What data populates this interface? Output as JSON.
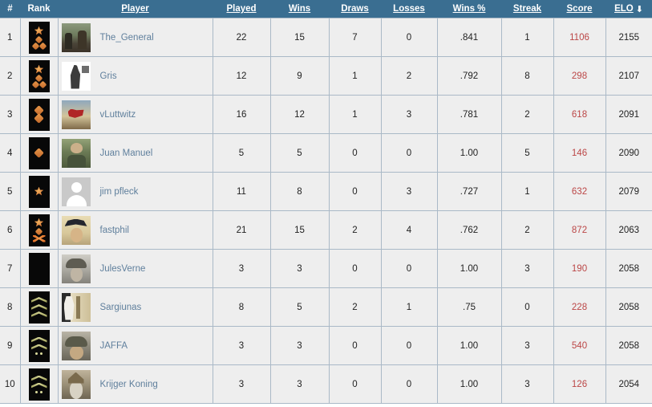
{
  "table": {
    "columns": [
      {
        "key": "num",
        "label": "#",
        "sortable": false,
        "sorted": false
      },
      {
        "key": "rank",
        "label": "Rank",
        "sortable": false,
        "sorted": false
      },
      {
        "key": "player",
        "label": "Player",
        "sortable": true,
        "sorted": false
      },
      {
        "key": "played",
        "label": "Played",
        "sortable": true,
        "sorted": false
      },
      {
        "key": "wins",
        "label": "Wins",
        "sortable": true,
        "sorted": false
      },
      {
        "key": "draws",
        "label": "Draws",
        "sortable": true,
        "sorted": false
      },
      {
        "key": "losses",
        "label": "Losses",
        "sortable": true,
        "sorted": false
      },
      {
        "key": "winpct",
        "label": "Wins %",
        "sortable": true,
        "sorted": false
      },
      {
        "key": "streak",
        "label": "Streak",
        "sortable": true,
        "sorted": false
      },
      {
        "key": "score",
        "label": "Score",
        "sortable": true,
        "sorted": false
      },
      {
        "key": "elo",
        "label": "ELO",
        "sortable": true,
        "sorted": true,
        "sort_direction": "desc",
        "sort_arrow": "⬇"
      }
    ],
    "rows": [
      {
        "num": "1",
        "player": "The_General",
        "played": "22",
        "wins": "15",
        "draws": "7",
        "losses": "0",
        "winpct": ".841",
        "streak": "1",
        "score": "1106",
        "elo": "2155",
        "rank_insignia": "two-diamonds-plus-one",
        "avatar_art": "av-landscape"
      },
      {
        "num": "2",
        "player": "Gris",
        "played": "12",
        "wins": "9",
        "draws": "1",
        "losses": "2",
        "winpct": ".792",
        "streak": "8",
        "score": "298",
        "elo": "2107",
        "rank_insignia": "two-diamonds-plus-one",
        "avatar_art": "av-cloak"
      },
      {
        "num": "3",
        "player": "vLuttwitz",
        "played": "16",
        "wins": "12",
        "draws": "1",
        "losses": "3",
        "winpct": ".781",
        "streak": "2",
        "score": "618",
        "elo": "2091",
        "rank_insignia": "two-diamonds",
        "avatar_art": "av-flag"
      },
      {
        "num": "4",
        "player": "Juan Manuel",
        "played": "5",
        "wins": "5",
        "draws": "0",
        "losses": "0",
        "winpct": "1.00",
        "streak": "5",
        "score": "146",
        "elo": "2090",
        "rank_insignia": "one-diamond",
        "avatar_art": "av-soldier"
      },
      {
        "num": "5",
        "player": "jim pfleck",
        "played": "11",
        "wins": "8",
        "draws": "0",
        "losses": "3",
        "winpct": ".727",
        "streak": "1",
        "score": "632",
        "elo": "2079",
        "rank_insignia": "star",
        "avatar_art": "av-anon"
      },
      {
        "num": "6",
        "player": "fastphil",
        "played": "21",
        "wins": "15",
        "draws": "2",
        "losses": "4",
        "winpct": ".762",
        "streak": "2",
        "score": "872",
        "elo": "2063",
        "rank_insignia": "star-diamond-cross",
        "avatar_art": "av-tricorn"
      },
      {
        "num": "7",
        "player": "JulesVerne",
        "played": "3",
        "wins": "3",
        "draws": "0",
        "losses": "0",
        "winpct": "1.00",
        "streak": "3",
        "score": "190",
        "elo": "2058",
        "rank_insignia": "blank",
        "avatar_art": "av-helmet"
      },
      {
        "num": "8",
        "player": "Sargiunas",
        "played": "8",
        "wins": "5",
        "draws": "2",
        "losses": "1",
        "winpct": ".75",
        "streak": "0",
        "score": "228",
        "elo": "2058",
        "rank_insignia": "three-chevrons",
        "avatar_art": "av-sargi"
      },
      {
        "num": "9",
        "player": "JAFFA",
        "played": "3",
        "wins": "3",
        "draws": "0",
        "losses": "0",
        "winpct": "1.00",
        "streak": "3",
        "score": "540",
        "elo": "2058",
        "rank_insignia": "two-chevrons-dots",
        "avatar_art": "av-jaffa"
      },
      {
        "num": "10",
        "player": "Krijger Koning",
        "played": "3",
        "wins": "3",
        "draws": "0",
        "losses": "0",
        "winpct": "1.00",
        "streak": "3",
        "score": "126",
        "elo": "2054",
        "rank_insignia": "two-chevrons-dots",
        "avatar_art": "av-krijger"
      }
    ]
  },
  "colors": {
    "header_background": "#3a6e91",
    "header_text": "#ffffff",
    "row_background": "#eeeeee",
    "row_border": "#aab9c7",
    "player_link": "#5f7f9c",
    "score_text": "#bb4646",
    "value_text": "#222222"
  }
}
